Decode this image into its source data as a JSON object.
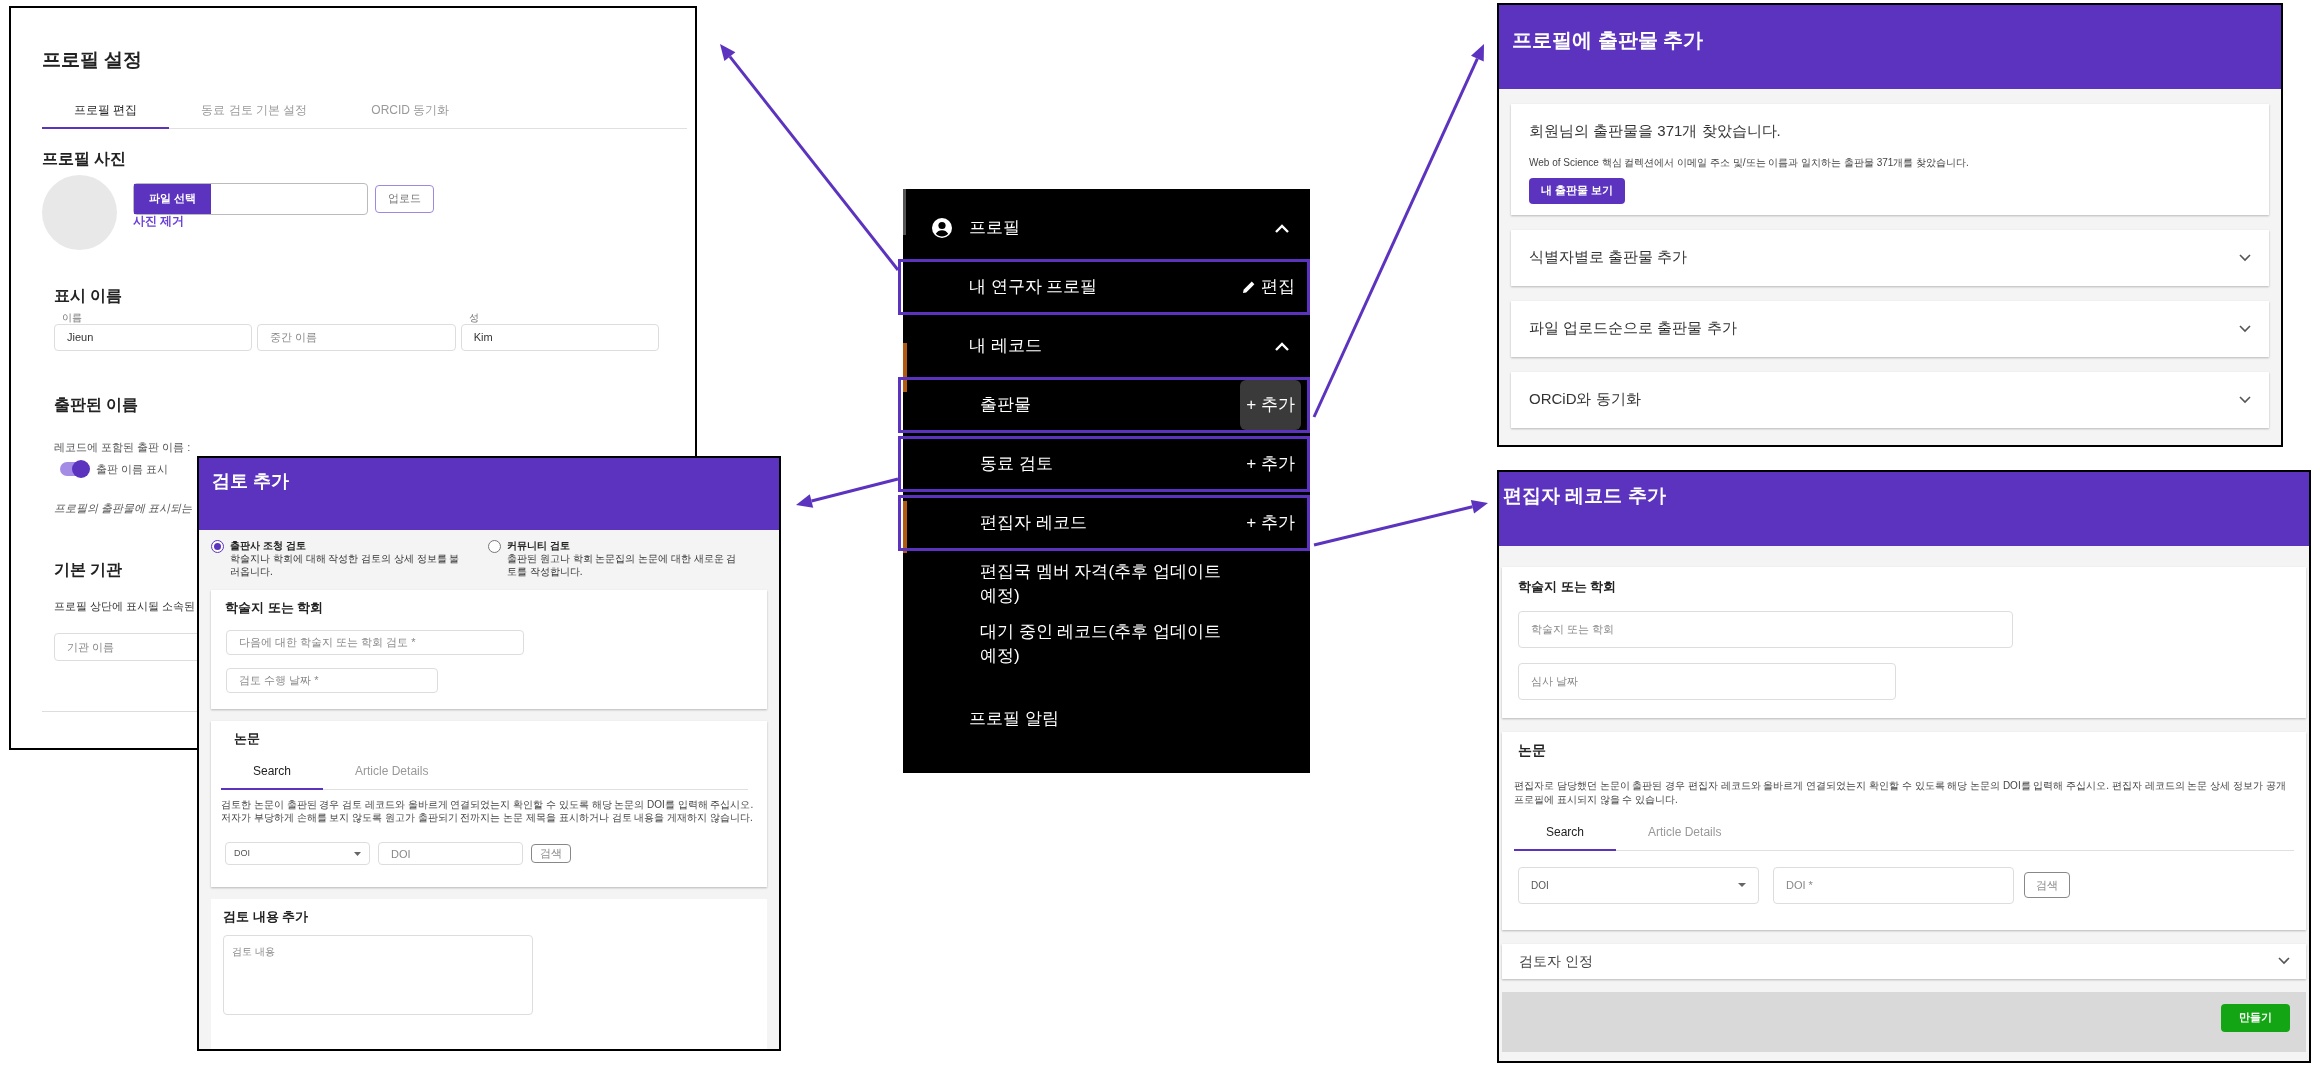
{
  "profile_settings": {
    "title": "프로필 설정",
    "tabs": [
      {
        "label": "프로필 편집",
        "selected": true
      },
      {
        "label": "동료 검토 기본 설정",
        "selected": false
      },
      {
        "label": "ORCID 동기화",
        "selected": false
      }
    ],
    "photo": {
      "heading": "프로필 사진",
      "choose_button": "파일 선택",
      "upload_button": "업로드",
      "remove_link": "사진 제거"
    },
    "display_name": {
      "heading": "표시 이름",
      "fields": [
        {
          "label": "이름",
          "value": "Jieun"
        },
        {
          "placeholder": "중간 이름"
        },
        {
          "label": "성",
          "value": "Kim"
        }
      ]
    },
    "published_name": {
      "heading": "출판된 이름",
      "label": "레코드에 포함된 출판 이름 :",
      "toggle": {
        "label": "출판 이름 표시",
        "on": true
      },
      "note": "프로필의 출판물에 표시되는"
    },
    "institution": {
      "heading": "기본 기관",
      "description": "프로필 상단에 표시될 소속된",
      "field": {
        "placeholder": "기관 이름"
      }
    }
  },
  "review_dialog": {
    "title": "검토 추가",
    "review_types": [
      {
        "title": "출판사 조청 검토",
        "description": "학술지나 학회에 대해 작성한 검토의 상세 정보를 불러옵니다.",
        "selected": true
      },
      {
        "title": "커뮤니티 검토",
        "description": "출판된 원고나 학회 논문집의 논문에 대한 새로운 검토를 작성합니다.",
        "selected": false
      }
    ],
    "journal_card": {
      "heading": "학술지 또는 학회",
      "fields": [
        {
          "placeholder": "다음에 대한 학술지 또는 학회 검토 *"
        },
        {
          "placeholder": "검토 수행 날짜 *"
        }
      ]
    },
    "article_card": {
      "heading": "논문",
      "tabs": [
        {
          "label": "Search",
          "selected": true
        },
        {
          "label": "Article Details",
          "selected": false
        }
      ],
      "description": "검토한 논문이 출판된 경우 검토 레코드와 올바르게 연결되었는지 확인할 수 있도록 해당 논문의 DOI를 입력해 주십시오. 저자가 부당하게 손해를 보지 않도록 원고가 출판되기 전까지는 논문 제목을 표시하거나 검토 내용을 게재하지 않습니다.",
      "id_type": "DOI",
      "doi_field": {
        "placeholder": "DOI"
      },
      "search_button": "검색"
    },
    "content_card": {
      "heading": "검토 내용 추가",
      "field": {
        "placeholder": "검토 내용"
      }
    }
  },
  "menu": {
    "items": [
      {
        "kind": "profile-header",
        "label": "프로필",
        "expanded": true,
        "highlighted": false
      },
      {
        "kind": "link",
        "label": "내 연구자 프로필",
        "action": {
          "kind": "edit",
          "label": "편집",
          "hovered": false
        },
        "highlighted": true
      },
      {
        "kind": "group",
        "label": "내 레코드",
        "expanded": true,
        "highlighted": false
      },
      {
        "kind": "subitem",
        "label": "출판물",
        "action": {
          "kind": "add",
          "label": "+ 추가",
          "hovered": true
        },
        "highlighted": true
      },
      {
        "kind": "subitem",
        "label": "동료 검토",
        "action": {
          "kind": "add",
          "label": "+ 추가",
          "hovered": false
        },
        "highlighted": true
      },
      {
        "kind": "subitem",
        "label": "편집자 레코드",
        "action": {
          "kind": "add",
          "label": "+ 추가",
          "hovered": false
        },
        "highlighted": true
      },
      {
        "kind": "subitem",
        "label": "편집국 멤버 자격(추후 업데이트 예정)",
        "highlighted": false
      },
      {
        "kind": "subitem",
        "label": "대기 중인 레코드(추후 업데이트 예정)",
        "highlighted": false
      },
      {
        "kind": "link",
        "label": "프로필 알림",
        "highlighted": false
      }
    ]
  },
  "publications_dialog": {
    "title": "프로필에 출판물 추가",
    "found": {
      "heading": "회원님의 출판물을 371개 찾았습니다.",
      "detail": "Web of Science 핵심 컬렉션에서 이메일 주소 및/또는 이름과 일치하는 출판물 371개를 찾았습니다.",
      "button": "내 출판물 보기"
    },
    "sections": [
      {
        "label": "식별자별로 출판물 추가",
        "expanded": false
      },
      {
        "label": "파일 업로드순으로 출판물 추가",
        "expanded": false
      },
      {
        "label": "ORCiD와 동기화",
        "expanded": false
      }
    ]
  },
  "editor_dialog": {
    "title": "편집자 레코드 추가",
    "journal_card": {
      "heading": "학술지 또는 학회",
      "fields": [
        {
          "placeholder": "학술지 또는 학회"
        },
        {
          "placeholder": "심사 날짜"
        }
      ]
    },
    "article_card": {
      "heading": "논문",
      "description": "편집자로 담당했던 논문이 출판된 경우 편집자 레코드와 올바르게 연결되었는지 확인할 수 있도록 해당 논문의 DOI를 입력해 주십시오. 편집자 레코드의 논문 상세 정보가 공개 프로필에 표시되지 않을 수 있습니다.",
      "tabs": [
        {
          "label": "Search",
          "selected": true
        },
        {
          "label": "Article Details",
          "selected": false
        }
      ],
      "id_type": "DOI",
      "doi_field": {
        "placeholder": "DOI *"
      },
      "search_button": "검색"
    },
    "sections": [
      {
        "label": "검토자 인정",
        "expanded": false
      }
    ],
    "create_button": "만들기"
  }
}
